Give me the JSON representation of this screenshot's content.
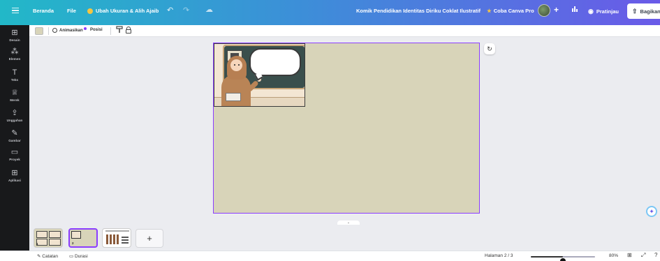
{
  "topbar": {
    "home": "Beranda",
    "file": "File",
    "resize": "Ubah Ukuran & Alih Ajaib",
    "undo_icon": "↶",
    "redo_icon": "↷",
    "cloud_icon": "☁",
    "doc_title": "Komik Pendidikan Identitas Diriku Coklat Ilustratif",
    "pro": "Coba Canva Pro",
    "plus_icon": "+",
    "stats_icon": "📊",
    "preview": "Pratinjau",
    "share": "Bagikan"
  },
  "sidebar": {
    "items": [
      {
        "icon": "⊞",
        "label": "Desain"
      },
      {
        "icon": "⁂",
        "label": "Elemen"
      },
      {
        "icon": "T",
        "label": "Teks"
      },
      {
        "icon": "♕",
        "label": "Merek"
      },
      {
        "icon": "⇪",
        "label": "Unggahan"
      },
      {
        "icon": "✎",
        "label": "Gambar"
      },
      {
        "icon": "▭",
        "label": "Proyek"
      },
      {
        "icon": "⊞",
        "label": "Aplikasi"
      }
    ]
  },
  "toolbar": {
    "animate": "Animasikan",
    "position": "Posisi",
    "paint_icon": "🖌"
  },
  "canvas": {
    "refresh_icon": "↻",
    "magic_icon": "✦",
    "collapse_icon": "⌄",
    "page_color": "#d8d4b9"
  },
  "pages": {
    "thumb1_num": "1",
    "thumb2_num": "2",
    "add": "+"
  },
  "status": {
    "notes": "Catatan",
    "duration": "Durasi",
    "page_indicator": "Halaman 2 / 3",
    "zoom": "80%",
    "zoom_fraction": 0.5,
    "grid_icon": "⊞",
    "fullscreen_icon": "⤢",
    "help_icon": "?"
  },
  "colors": {
    "accent": "#8b3dff",
    "sidebar_bg": "#18191b"
  }
}
